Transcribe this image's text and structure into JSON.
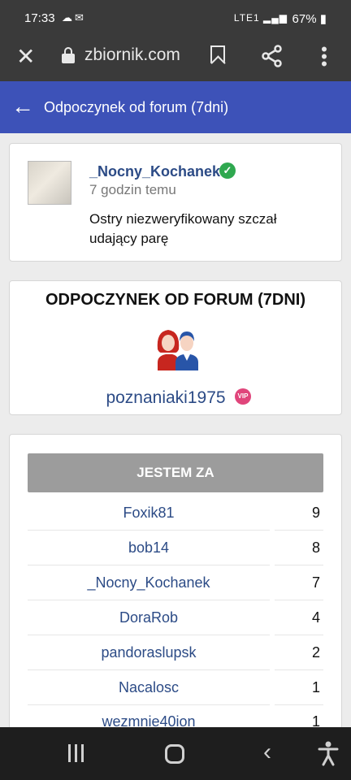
{
  "status": {
    "time": "17:33",
    "battery": "67%",
    "network": "LTE1"
  },
  "browser": {
    "url": "zbiornik.com"
  },
  "header": {
    "title": "Odpoczynek od forum (7dni)"
  },
  "post": {
    "author": "_Nocny_Kochanek",
    "time_ago": "7 godzin temu",
    "text": "Ostry niezweryfikowany szczał udający parę"
  },
  "forum": {
    "title": "ODPOCZYNEK OD FORUM (7DNI)",
    "creator": "poznaniaki1975",
    "badge": "VIP"
  },
  "votes": {
    "button_label": "JESTEM ZA",
    "rows": [
      {
        "name": "Foxik81",
        "count": "9"
      },
      {
        "name": "bob14",
        "count": "8"
      },
      {
        "name": "_Nocny_Kochanek",
        "count": "7"
      },
      {
        "name": "DoraRob",
        "count": "4"
      },
      {
        "name": "pandoraslupsk",
        "count": "2"
      },
      {
        "name": "Nacalosc",
        "count": "1"
      },
      {
        "name": "wezmnie40ion",
        "count": "1"
      }
    ]
  },
  "colors": {
    "accent": "#3d52b8",
    "link": "#2c4b86",
    "verified": "#2fa84f",
    "vip": "#e0457b"
  }
}
